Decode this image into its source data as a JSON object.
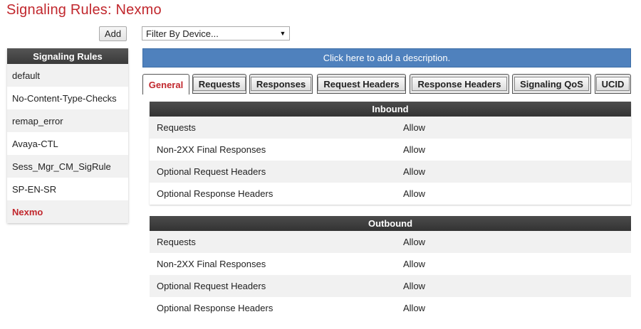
{
  "page_title": "Signaling Rules: Nexmo",
  "add_label": "Add",
  "filter": {
    "value": "Filter By Device...",
    "arrow": "▼"
  },
  "sidebar": {
    "header": "Signaling Rules",
    "items": [
      {
        "label": "default"
      },
      {
        "label": "No-Content-Type-Checks"
      },
      {
        "label": "remap_error"
      },
      {
        "label": "Avaya-CTL"
      },
      {
        "label": "Sess_Mgr_CM_SigRule"
      },
      {
        "label": "SP-EN-SR"
      },
      {
        "label": "Nexmo",
        "active": true
      }
    ]
  },
  "description_label": "Click here to add a description.",
  "tabs": [
    {
      "label": "General",
      "active": true
    },
    {
      "label": "Requests"
    },
    {
      "label": "Responses"
    },
    {
      "label": "Request Headers"
    },
    {
      "label": "Response Headers"
    },
    {
      "label": "Signaling QoS"
    },
    {
      "label": "UCID"
    }
  ],
  "inbound": {
    "title": "Inbound",
    "rows": [
      {
        "key": "Requests",
        "value": "Allow"
      },
      {
        "key": "Non-2XX Final Responses",
        "value": "Allow"
      },
      {
        "key": "Optional Request Headers",
        "value": "Allow"
      },
      {
        "key": "Optional Response Headers",
        "value": "Allow"
      }
    ]
  },
  "outbound": {
    "title": "Outbound",
    "rows": [
      {
        "key": "Requests",
        "value": "Allow"
      },
      {
        "key": "Non-2XX Final Responses",
        "value": "Allow"
      },
      {
        "key": "Optional Request Headers",
        "value": "Allow"
      },
      {
        "key": "Optional Response Headers",
        "value": "Allow"
      }
    ]
  },
  "colors": {
    "title": "#c1272d",
    "description_bar": "#4f81bd",
    "header_dark": "#3a3a3a"
  }
}
